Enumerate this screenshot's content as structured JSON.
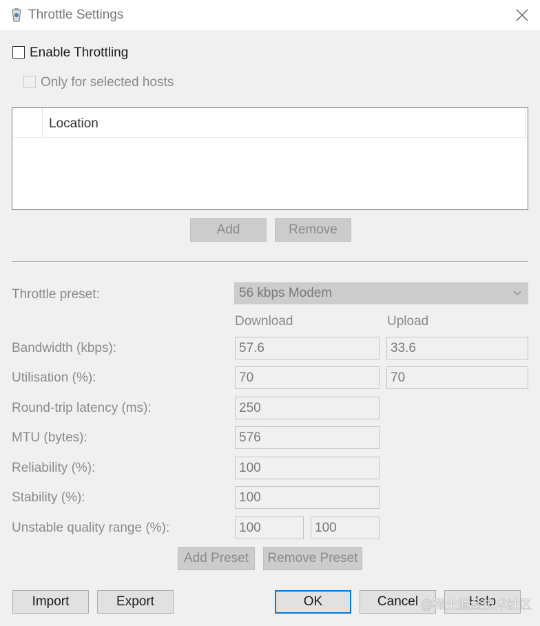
{
  "window": {
    "title": "Throttle Settings"
  },
  "enable_throttling": {
    "label": "Enable Throttling",
    "checked": false
  },
  "only_selected_hosts": {
    "label": "Only for selected hosts",
    "checked": false,
    "enabled": false
  },
  "hosts_table": {
    "columns": [
      "",
      "Location"
    ],
    "rows": []
  },
  "host_buttons": {
    "add": "Add",
    "remove": "Remove"
  },
  "preset": {
    "label": "Throttle preset:",
    "value": "56 kbps Modem"
  },
  "columns": {
    "download": "Download",
    "upload": "Upload"
  },
  "fields": {
    "bandwidth": {
      "label": "Bandwidth (kbps):",
      "download": "57.6",
      "upload": "33.6"
    },
    "utilisation": {
      "label": "Utilisation (%):",
      "download": "70",
      "upload": "70"
    },
    "latency": {
      "label": "Round-trip latency (ms):",
      "value": "250"
    },
    "mtu": {
      "label": "MTU (bytes):",
      "value": "576"
    },
    "reliability": {
      "label": "Reliability (%):",
      "value": "100"
    },
    "stability": {
      "label": "Stability (%):",
      "value": "100"
    },
    "unstable_range": {
      "label": "Unstable quality range (%):",
      "min": "100",
      "max": "100"
    }
  },
  "preset_buttons": {
    "add": "Add Preset",
    "remove": "Remove Preset"
  },
  "footer": {
    "import": "Import",
    "export": "Export",
    "ok": "OK",
    "cancel": "Cancel",
    "help": "Help"
  },
  "watermark": "@稀土掘金技术社区"
}
